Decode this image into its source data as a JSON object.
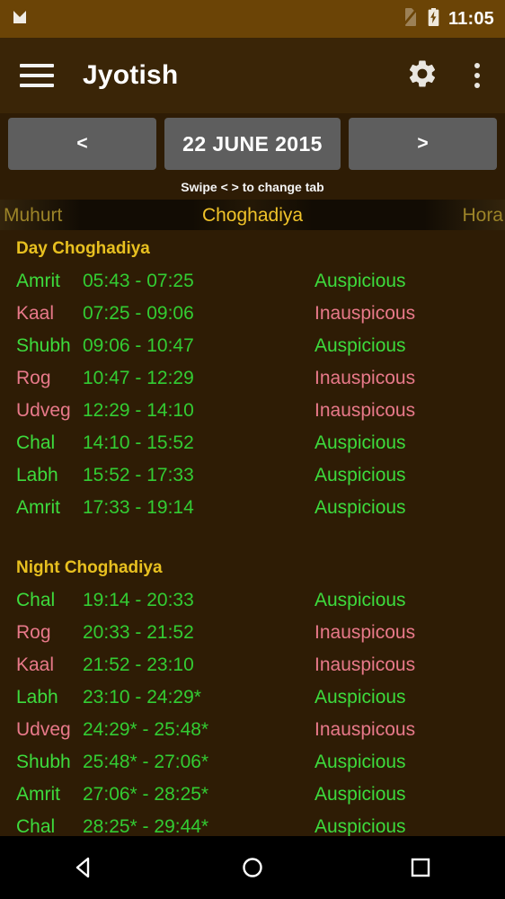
{
  "status_bar": {
    "time": "11:05",
    "icons": [
      "mail-icon",
      "no-sim-icon",
      "battery-charging-icon"
    ]
  },
  "app_bar": {
    "menu_icon": "hamburger-menu-icon",
    "title": "Jyotish",
    "settings_icon": "gear-icon",
    "overflow_icon": "overflow-menu-icon"
  },
  "date_nav": {
    "prev_label": "<",
    "date_label": "22 JUNE 2015",
    "next_label": ">"
  },
  "swipe_hint": "Swipe < > to change tab",
  "tabs": {
    "left": "Muhurt",
    "center": "Choghadiya",
    "right": "Hora",
    "selected": "Choghadiya",
    "selected_color": "#f0c32a",
    "unselected_color": "#9c8428"
  },
  "colors": {
    "background": "#2e1c05",
    "status_bar": "#6b4406",
    "app_bar": "#3a2507",
    "section_header": "#e8c020",
    "time_text": "#33cc33",
    "auspicious": "#3ddb3d",
    "inauspicious": "#e8798a",
    "button": "#5e5e5e"
  },
  "day_section": {
    "title": "Day Choghadiya",
    "rows": [
      {
        "name": "Amrit",
        "time": "05:43 - 07:25",
        "status": "Auspicious",
        "good": true
      },
      {
        "name": "Kaal",
        "time": "07:25 - 09:06",
        "status": "Inauspicous",
        "good": false
      },
      {
        "name": "Shubh",
        "time": "09:06 - 10:47",
        "status": "Auspicious",
        "good": true
      },
      {
        "name": "Rog",
        "time": "10:47 - 12:29",
        "status": "Inauspicous",
        "good": false
      },
      {
        "name": "Udveg",
        "time": "12:29 - 14:10",
        "status": "Inauspicous",
        "good": false
      },
      {
        "name": "Chal",
        "time": "14:10 - 15:52",
        "status": "Auspicious",
        "good": true
      },
      {
        "name": "Labh",
        "time": "15:52 - 17:33",
        "status": "Auspicious",
        "good": true
      },
      {
        "name": "Amrit",
        "time": "17:33 - 19:14",
        "status": "Auspicious",
        "good": true
      }
    ]
  },
  "night_section": {
    "title": "Night Choghadiya",
    "rows": [
      {
        "name": "Chal",
        "time": "19:14 - 20:33",
        "status": "Auspicious",
        "good": true
      },
      {
        "name": "Rog",
        "time": "20:33 - 21:52",
        "status": "Inauspicous",
        "good": false
      },
      {
        "name": "Kaal",
        "time": "21:52 - 23:10",
        "status": "Inauspicous",
        "good": false
      },
      {
        "name": "Labh",
        "time": "23:10 - 24:29*",
        "status": "Auspicious",
        "good": true
      },
      {
        "name": "Udveg",
        "time": "24:29* - 25:48*",
        "status": "Inauspicous",
        "good": false
      },
      {
        "name": "Shubh",
        "time": "25:48* - 27:06*",
        "status": "Auspicious",
        "good": true
      },
      {
        "name": "Amrit",
        "time": "27:06* - 28:25*",
        "status": "Auspicious",
        "good": true
      },
      {
        "name": "Chal",
        "time": "28:25* - 29:44*",
        "status": "Auspicious",
        "good": true
      }
    ]
  },
  "nav_bar": {
    "back": "back-triangle-icon",
    "home": "home-circle-icon",
    "recents": "recents-square-icon"
  }
}
